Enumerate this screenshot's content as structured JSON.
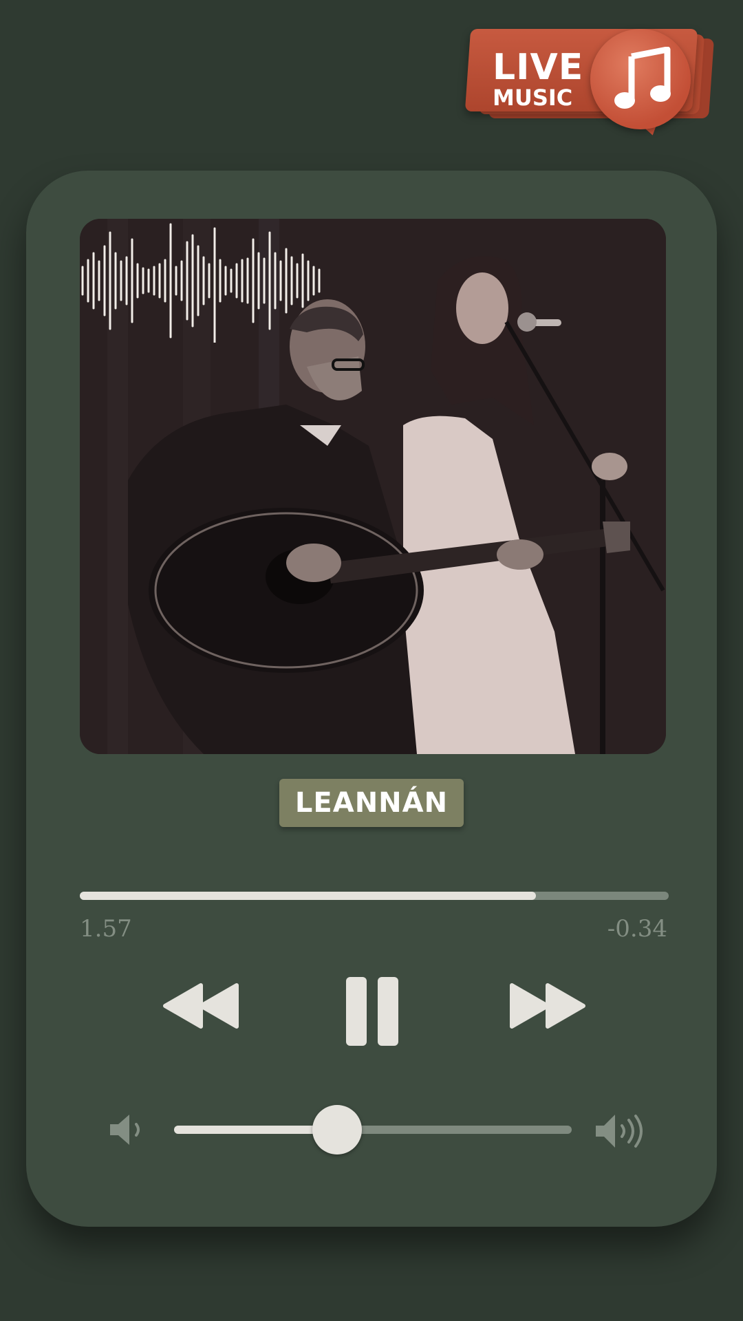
{
  "badge": {
    "line1": "LIVE",
    "line2": "MUSIC",
    "icon": "music-note-icon"
  },
  "track": {
    "title": "LEANNÁN"
  },
  "progress": {
    "elapsed": "1.57",
    "remaining": "-0.34",
    "fraction": 0.775
  },
  "controls": {
    "rewind_icon": "rewind-icon",
    "pause_icon": "pause-icon",
    "forward_icon": "fast-forward-icon"
  },
  "volume": {
    "low_icon": "volume-low-icon",
    "high_icon": "volume-high-icon",
    "level": 0.41
  },
  "colors": {
    "background": "#2f3a31",
    "card": "#3e4c40",
    "accent": "#e5e3dd",
    "badge_red": "#c34f36",
    "title_badge": "#7d8062"
  }
}
